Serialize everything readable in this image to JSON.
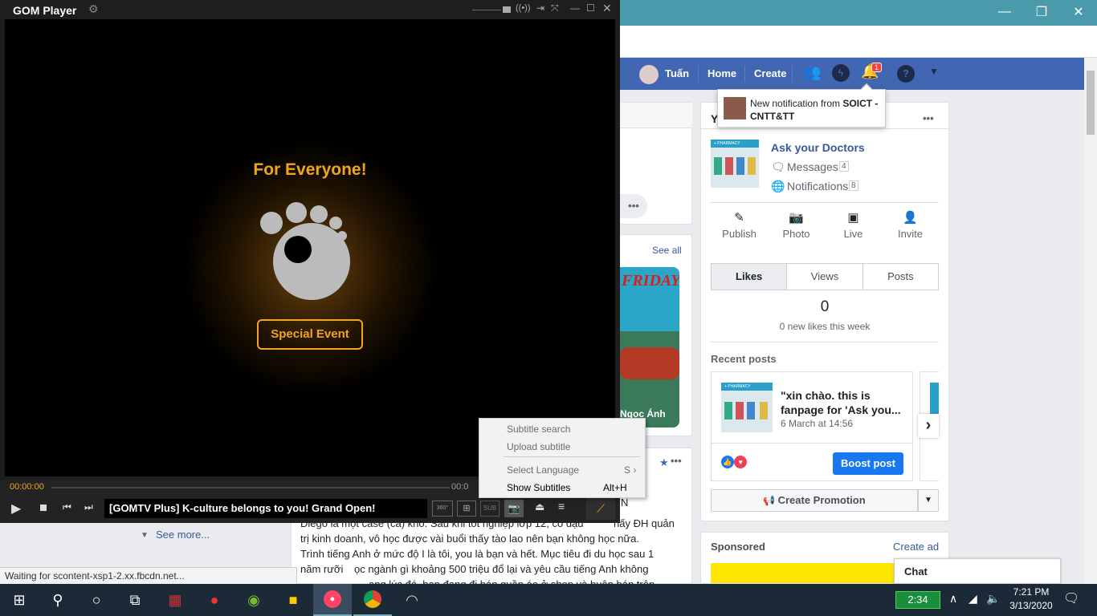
{
  "gom": {
    "title": "GOM Player",
    "time_current": "00:00:00",
    "time_total": "00:0",
    "promo_heading": "For Everyone!",
    "promo_button": "Special Event",
    "marquee": "[GOMTV Plus] K-culture belongs to you! Grand Open!",
    "sub_label": "SUB",
    "btn360": "360°"
  },
  "context_menu": {
    "items": [
      {
        "label": "Subtitle search",
        "shortcut": ""
      },
      {
        "label": "Upload subtitle",
        "shortcut": ""
      },
      {
        "label": "Select Language",
        "shortcut": "S ›"
      },
      {
        "label": "Show Subtitles",
        "shortcut": "Alt+H"
      }
    ]
  },
  "fb_header": {
    "user": "Tuấn",
    "home": "Home",
    "create": "Create",
    "notif_count": "1"
  },
  "notification": {
    "prefix": "New notification from ",
    "source": "SOICT - CNTT&TT"
  },
  "page_panel": {
    "heading_initial": "Y",
    "page_name": "Ask your Doctors",
    "thumb_label": "+ PHARMACY",
    "messages_label": "Messages",
    "messages_count": "4",
    "notifications_label": "Notifications",
    "notifications_count": "8",
    "actions": [
      "Publish",
      "Photo",
      "Live",
      "Invite"
    ],
    "tabs": [
      "Likes",
      "Views",
      "Posts"
    ],
    "likes_count": "0",
    "likes_caption": "0 new likes this week",
    "recent_posts_label": "Recent posts",
    "post_title": "\"xin chào. this is fanpage for 'Ask you...",
    "post_date": "6 March at 14:56",
    "boost_button": "Boost post",
    "create_promotion": "Create Promotion"
  },
  "sponsored": {
    "label": "Sponsored",
    "create_ad": "Create ad"
  },
  "chat": {
    "label": "Chat"
  },
  "stories": {
    "see_all": "See all",
    "story_label": "Ngọc Ánh",
    "friday_text": "FRIDAY"
  },
  "left": {
    "see_more": "See more..."
  },
  "post": {
    "letter_n": "N",
    "line1_end": "hấy ĐH quản",
    "line2": "trị kinh doanh, vô học được vài buổi thấy tào lao nên bạn không học nữa.",
    "line3": "Trình tiếng Anh ở mức độ I là tôi, you là bạn và hết. Mục tiêu đi du học sau 1",
    "line4_start": "năm rưỡi",
    "line4_end": "ọc ngành gì khoảng 500 triệu đổ lại và yêu cầu tiếng Anh không",
    "line5_end": "ang lúc đó, bạn đang đi bán quần áo ở shop và buôn bán trên",
    "line0": "Diego là một case (ca) khó. Sau khi tốt nghiệp lớp 12, có đậu"
  },
  "status_bar": {
    "text": "Waiting for scontent-xsp1-2.xx.fbcdn.net..."
  },
  "taskbar": {
    "battery_time": "2:34",
    "time": "7:21 PM",
    "date": "3/13/2020"
  }
}
